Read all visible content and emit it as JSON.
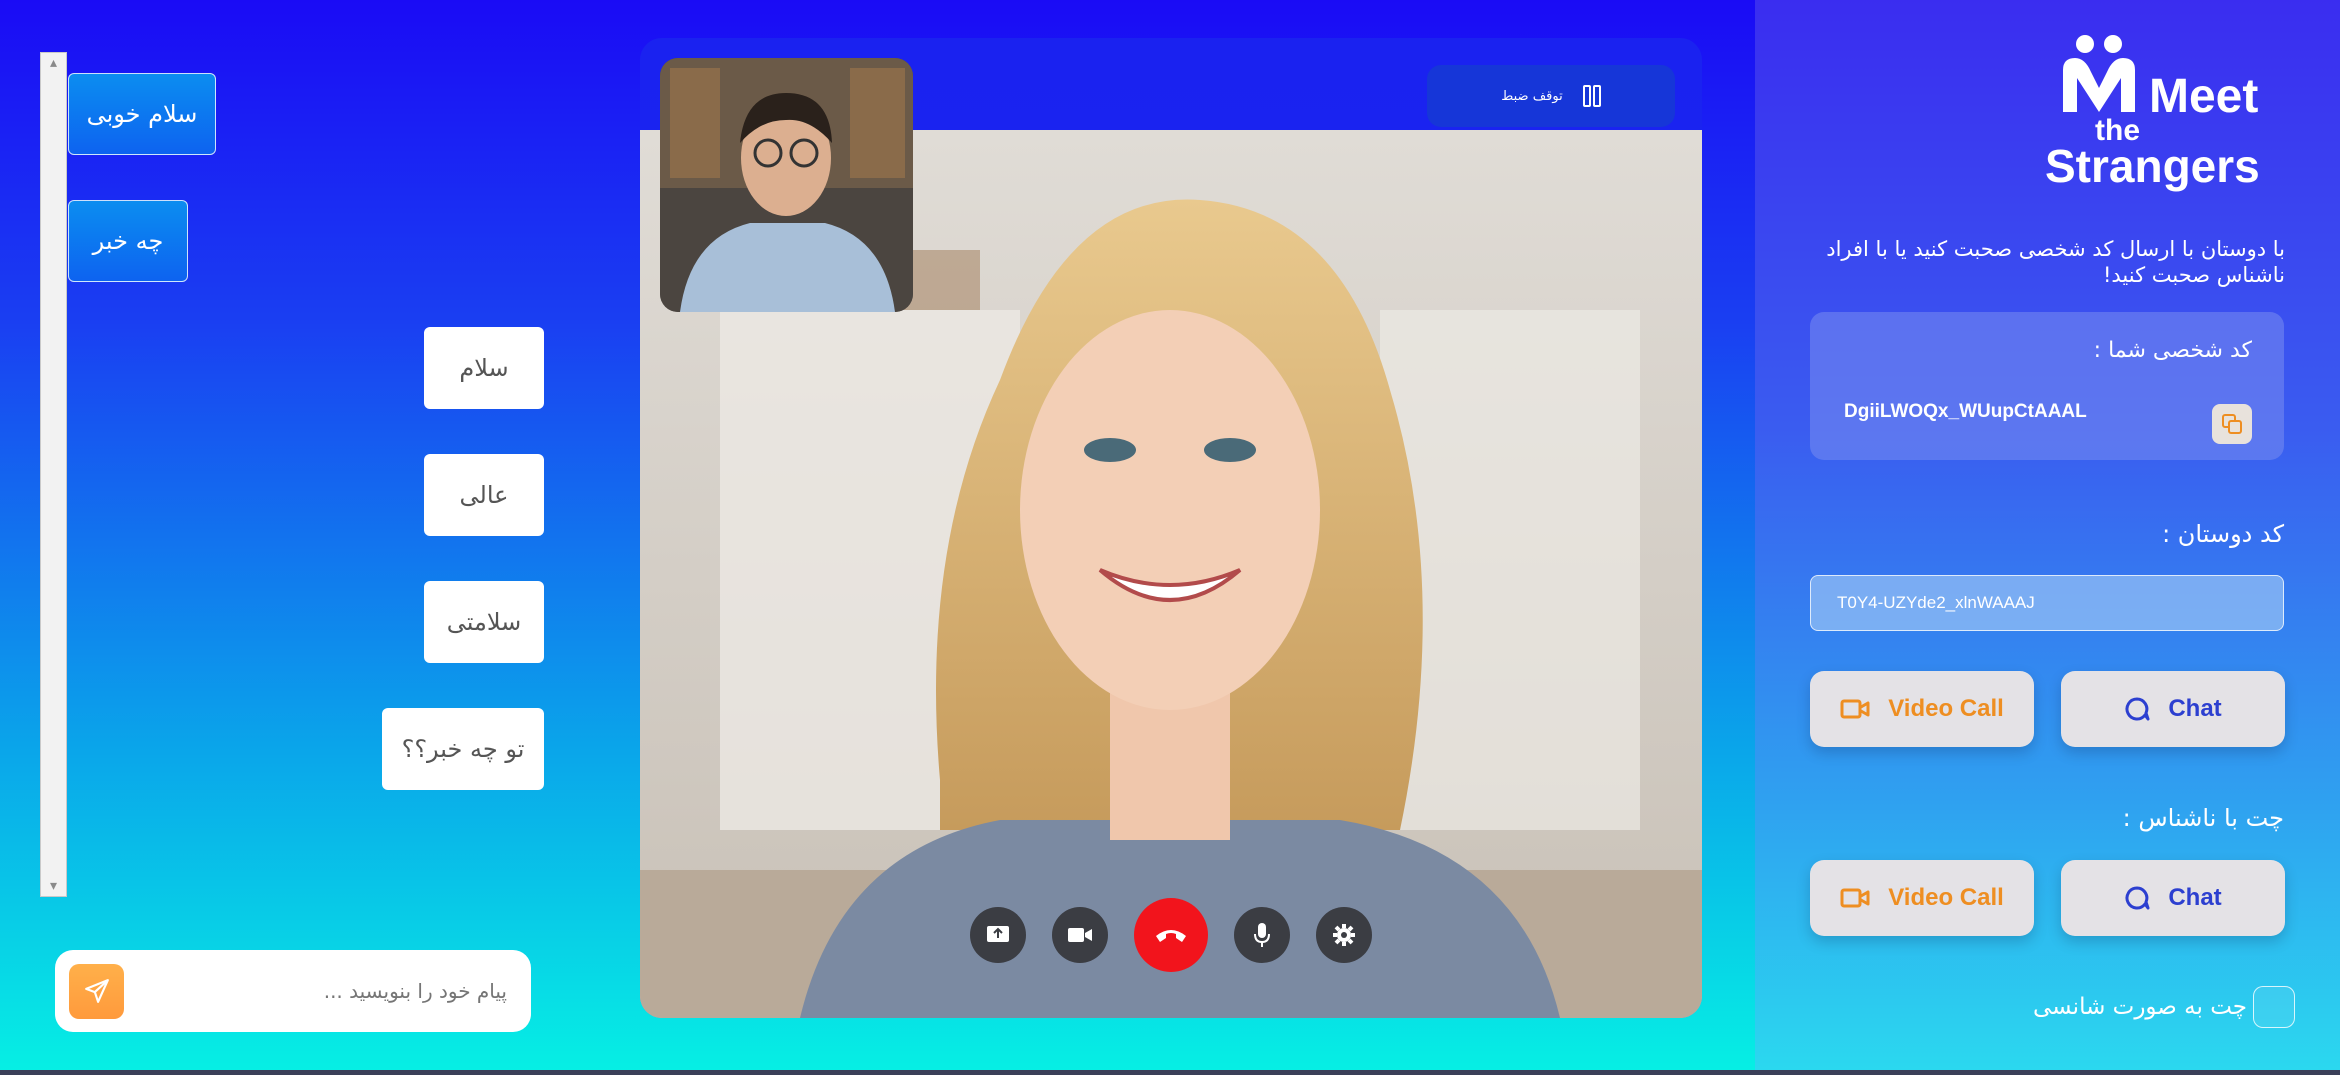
{
  "chat": {
    "messages": [
      {
        "text": "سلام خوبی",
        "side": "sent"
      },
      {
        "text": "چه خبر",
        "side": "sent"
      },
      {
        "text": "سلام",
        "side": "received"
      },
      {
        "text": "عالی",
        "side": "received"
      },
      {
        "text": "سلامتی",
        "side": "received"
      },
      {
        "text": "تو چه خبر؟؟",
        "side": "received"
      }
    ],
    "input_placeholder": "پیام خود را بنویسید ...",
    "send_icon": "send-icon"
  },
  "video": {
    "record_label": "توقف ضبط",
    "record_icon": "pause-icon",
    "controls": [
      {
        "name": "screen-share-icon"
      },
      {
        "name": "camera-icon"
      },
      {
        "name": "end-call-icon"
      },
      {
        "name": "mic-icon"
      },
      {
        "name": "settings-icon"
      }
    ]
  },
  "sidebar": {
    "logo": {
      "line1": "Meet",
      "line2": "the",
      "line3": "Strangers"
    },
    "intro": "با دوستان با ارسال کد شخصی صحبت کنید یا با افراد ناشناس صحبت کنید!",
    "personal_code_title": "کد شخصی شما :",
    "personal_code": "DgiiLWOQx_WUupCtAAAL",
    "friends_code_title": "کد دوستان :",
    "friend_code_value": "T0Y4-UZYde2_xlnWAAAJ",
    "video_call_label": "Video Call",
    "chat_label": "Chat",
    "stranger_title": "چت با ناشناس :",
    "face_chat_label": "چت به صورت شانسی",
    "colors": {
      "video_orange": "#ee8e22",
      "chat_blue": "#2c3fd0",
      "end_call_red": "#f2141c"
    }
  }
}
